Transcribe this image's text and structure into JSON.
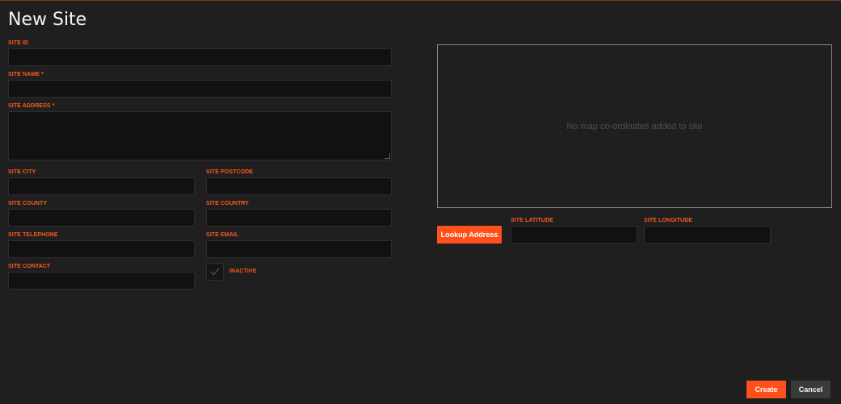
{
  "page": {
    "title": "New Site"
  },
  "form": {
    "site_id": {
      "label": "SITE ID",
      "value": ""
    },
    "site_name": {
      "label": "SITE NAME *",
      "value": ""
    },
    "site_address": {
      "label": "SITE ADDRESS *",
      "value": ""
    },
    "site_city": {
      "label": "SITE CITY",
      "value": ""
    },
    "site_postcode": {
      "label": "SITE POSTCODE",
      "value": ""
    },
    "site_county": {
      "label": "SITE COUNTY",
      "value": ""
    },
    "site_country": {
      "label": "SITE COUNTRY",
      "value": ""
    },
    "site_telephone": {
      "label": "SITE TELEPHONE",
      "value": ""
    },
    "site_email": {
      "label": "SITE EMAIL",
      "value": ""
    },
    "site_contact": {
      "label": "SITE CONTACT",
      "value": ""
    },
    "inactive": {
      "label": "INACTIVE",
      "checked": false
    }
  },
  "map": {
    "message": "No map co-ordinates added to site"
  },
  "geo": {
    "lookup_label": "Lookup Address",
    "latitude": {
      "label": "SITE LATITUDE",
      "value": ""
    },
    "longitude": {
      "label": "SITE LONGITUDE",
      "value": ""
    }
  },
  "actions": {
    "create_label": "Create",
    "cancel_label": "Cancel"
  },
  "colors": {
    "accent": "#ff4f1a",
    "background": "#1f1f1f",
    "input_background": "#111111",
    "label": "#ff5a1f"
  }
}
